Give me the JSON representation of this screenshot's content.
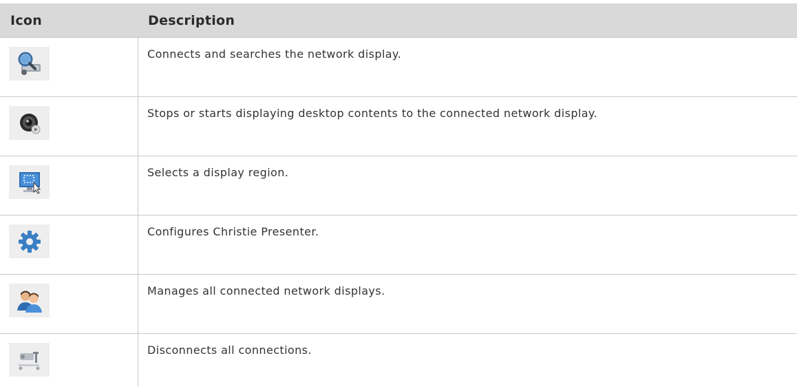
{
  "table": {
    "headers": {
      "icon": "Icon",
      "description": "Description"
    },
    "rows": [
      {
        "icon": "network-search-icon",
        "description": "Connects and searches the network display."
      },
      {
        "icon": "camera-play-icon",
        "description": "Stops or starts displaying desktop contents to the connected network display."
      },
      {
        "icon": "region-select-icon",
        "description": "Selects a display region."
      },
      {
        "icon": "gear-icon",
        "description": "Configures Christie Presenter."
      },
      {
        "icon": "users-icon",
        "description": "Manages all connected network displays."
      },
      {
        "icon": "disconnect-icon",
        "description": "Disconnects all connections."
      }
    ]
  },
  "colors": {
    "header_bg": "#d9d9d9",
    "icon_tile_bg": "#eeeeee",
    "grid_line": "#c9c9c9",
    "icon_blue": "#3a7fc4"
  }
}
